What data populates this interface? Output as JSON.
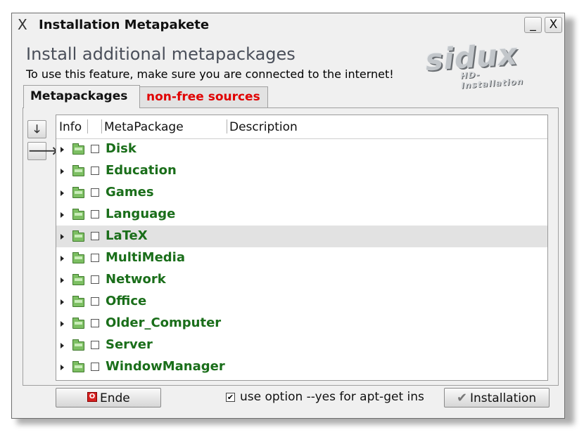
{
  "window": {
    "title": "Installation Metapakete",
    "wm_icon": "X",
    "minimize_label": "_",
    "close_label": "X"
  },
  "header": {
    "heading": "Install additional metapackages",
    "subheading": "To use this feature, make sure you are connected to the internet!"
  },
  "logo": {
    "main": "sidux",
    "sub": "HD-Installation"
  },
  "tabs": [
    {
      "label": "Metapackages",
      "active": true
    },
    {
      "label": "non-free sources",
      "active": false,
      "color": "#e00000"
    }
  ],
  "side_buttons": [
    {
      "label": "🡓",
      "icon": "arrow-down-icon"
    },
    {
      "label": "🡒",
      "icon": "arrow-right-icon"
    }
  ],
  "tree": {
    "columns": [
      "Info",
      "MetaPackage",
      "Description"
    ],
    "rows": [
      {
        "label": "Disk",
        "selected": false,
        "checked": false
      },
      {
        "label": "Education",
        "selected": false,
        "checked": false
      },
      {
        "label": "Games",
        "selected": false,
        "checked": false
      },
      {
        "label": "Language",
        "selected": false,
        "checked": false
      },
      {
        "label": "LaTeX",
        "selected": true,
        "checked": false
      },
      {
        "label": "MultiMedia",
        "selected": false,
        "checked": false
      },
      {
        "label": "Network",
        "selected": false,
        "checked": false
      },
      {
        "label": "Office",
        "selected": false,
        "checked": false
      },
      {
        "label": "Older_Computer",
        "selected": false,
        "checked": false
      },
      {
        "label": "Server",
        "selected": false,
        "checked": false
      },
      {
        "label": "WindowManager",
        "selected": false,
        "checked": false
      }
    ],
    "label_color": "#1a6e1a",
    "folder_icon": "folder-icon"
  },
  "footer": {
    "ende_label": "Ende",
    "ende_icon": "quit-icon",
    "option_label": "use option --yes for apt-get ins",
    "option_checked": true,
    "option_check_glyph": "✔",
    "install_label": "Installation",
    "install_icon": "checkmark-icon",
    "install_glyph": "✔"
  }
}
